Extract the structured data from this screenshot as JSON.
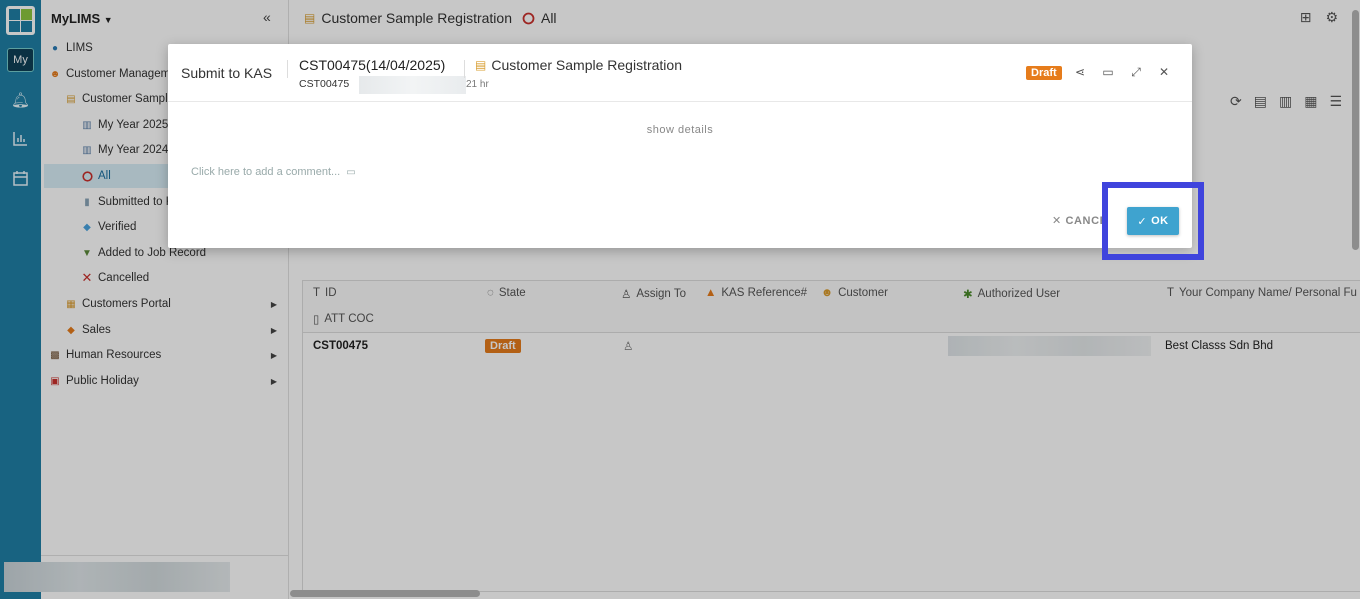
{
  "app": {
    "name": "MyLIMS",
    "rail_label": "My"
  },
  "sidebar": {
    "items": [
      {
        "label": "LIMS",
        "icon": "globe-icon"
      },
      {
        "label": "Customer Managem",
        "icon": "customer-icon"
      },
      {
        "label": "Customer Sample",
        "icon": "scroll-icon"
      },
      {
        "label": "My Year 2025",
        "icon": "chart-icon"
      },
      {
        "label": "My Year 2024",
        "icon": "chart-icon"
      },
      {
        "label": "All",
        "icon": "circle-icon"
      },
      {
        "label": "Submitted to K",
        "icon": "document-icon"
      },
      {
        "label": "Verified",
        "icon": "gem-icon"
      },
      {
        "label": "Added to Job Record",
        "icon": "inbox-icon"
      },
      {
        "label": "Cancelled",
        "icon": "cross-icon"
      },
      {
        "label": "Customers Portal",
        "icon": "portal-icon"
      },
      {
        "label": "Sales",
        "icon": "diamond-icon"
      },
      {
        "label": "Human Resources",
        "icon": "people-icon"
      },
      {
        "label": "Public Holiday",
        "icon": "calendar-icon"
      }
    ]
  },
  "main": {
    "title": "Customer Sample Registration",
    "filter": "All",
    "columns": [
      "ID",
      "State",
      "Assign To",
      "KAS Reference#",
      "Customer",
      "Authorized User",
      "Your Company Name/ Personal Fu",
      "ATT COC"
    ],
    "rows": [
      {
        "id": "CST00475",
        "state": "Draft",
        "company": "Best Classs Sdn Bhd"
      }
    ]
  },
  "dialog": {
    "title": "Submit to KAS",
    "record": "CST00475(14/04/2025)",
    "record_id": "CST00475",
    "elapsed": "21 hr",
    "form_name": "Customer Sample Registration",
    "status": "Draft",
    "show_details": "show details",
    "comment_placeholder": "Click here to add a comment...",
    "cancel_label": "✕ CANCE",
    "ok_label": "OK"
  },
  "colors": {
    "rail": "#1f7fa6",
    "accent": "#3fa3cf",
    "draft": "#e67c1b",
    "highlight": "#3f44dd"
  }
}
